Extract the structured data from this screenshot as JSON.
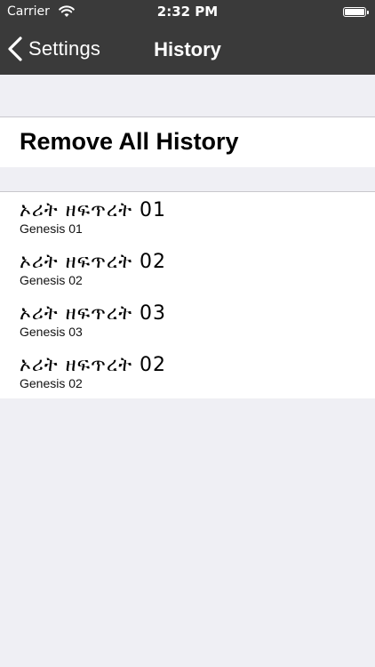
{
  "status_bar": {
    "carrier": "Carrier",
    "time": "2:32 PM"
  },
  "nav": {
    "back_label": "Settings",
    "title": "History"
  },
  "actions": {
    "remove_all": "Remove All History"
  },
  "history": [
    {
      "title": "ኦሪት ዘፍጥረት 01",
      "subtitle": "Genesis  01"
    },
    {
      "title": "ኦሪት ዘፍጥረት 02",
      "subtitle": "Genesis  02"
    },
    {
      "title": "ኦሪት ዘፍጥረት 03",
      "subtitle": "Genesis  03"
    },
    {
      "title": "ኦሪት ዘፍጥረት 02",
      "subtitle": "Genesis  02"
    }
  ],
  "colors": {
    "bar_background": "#3a3a3a",
    "page_background": "#efeff4",
    "cell_background": "#ffffff",
    "separator": "#c8c7cc"
  },
  "icons": {
    "back": "chevron-left-icon",
    "wifi": "wifi-icon",
    "battery": "battery-icon"
  }
}
